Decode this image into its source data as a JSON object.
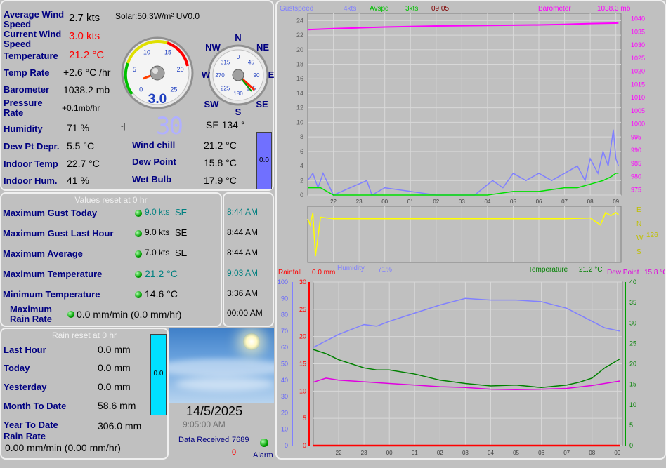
{
  "current": {
    "avg_wind_label": "Average Wind Speed",
    "avg_wind_value": "2.7 kts",
    "solar_text": "Solar:50.3W/m² UV0.0",
    "cur_wind_label": "Current Wind Speed",
    "cur_wind_value": "3.0 kts",
    "temp_label": "Temperature",
    "temp_value": "21.2 °C",
    "temp_rate_label": "Temp Rate",
    "temp_rate_value": "+2.6 °C /hr",
    "baro_label": "Barometer",
    "baro_value": "1038.2 mb",
    "pressure_rate_label": "Pressure Rate",
    "pressure_rate_value": "+0.1mb/hr",
    "humidity_label": "Humidity",
    "humidity_value": "71 %",
    "dew_depr_label": "Dew Pt Depr.",
    "dew_depr_value": "5.5 °C",
    "indoor_temp_label": "Indoor Temp",
    "indoor_temp_value": "22.7 °C",
    "indoor_hum_label": "Indoor Hum.",
    "indoor_hum_value": "41 %",
    "wind_chill_label": "Wind chill",
    "wind_chill_value": "21.2 °C",
    "dew_point_label": "Dew Point",
    "dew_point_value": "15.8 °C",
    "wet_bulb_label": "Wet Bulb",
    "wet_bulb_value": "17.9 °C",
    "wind_dir_text": "SE  134 °",
    "digital_dir": "30",
    "minus_sign": "-|",
    "gauge_value": "3.0",
    "bar_value": "0.0",
    "compass": {
      "n": "N",
      "ne": "NE",
      "e": "E",
      "se": "SE",
      "s": "S",
      "sw": "SW",
      "w": "W",
      "nw": "NW"
    }
  },
  "gauge_speed_ticks": [
    "0",
    "5",
    "10",
    "15",
    "20",
    "25"
  ],
  "gauge_compass_ticks": [
    "0",
    "45",
    "90",
    "135",
    "180",
    "225",
    "270",
    "315"
  ],
  "maxima": {
    "title": "Values reset at 0 hr",
    "rows": [
      {
        "label": "Maximum Gust Today",
        "value": "9.0 kts",
        "dir": "SE",
        "time": "8:44 AM",
        "color": "#008080"
      },
      {
        "label": "Maximum Gust Last Hour",
        "value": "9.0 kts",
        "dir": "SE",
        "time": "8:44 AM",
        "color": "#000000"
      },
      {
        "label": "Maximum Average",
        "value": "7.0 kts",
        "dir": "SE",
        "time": "8:44 AM",
        "color": "#000000"
      },
      {
        "label": "Maximum Temperature",
        "value": "21.2 °C",
        "dir": "",
        "time": "9:03 AM",
        "color": "#008080"
      },
      {
        "label": "Minimum Temperature",
        "value": "14.6 °C",
        "dir": "",
        "time": "3:36 AM",
        "color": "#000000"
      }
    ],
    "rain_rate_label": "Maximum Rain Rate",
    "rain_rate_value": "0.0 mm/min (0.0 mm/hr)",
    "rain_rate_time": "00:00 AM"
  },
  "rain": {
    "title": "Rain reset at 0 hr",
    "last_hour_label": "Last Hour",
    "last_hour_value": "0.0 mm",
    "today_label": "Today",
    "today_value": "0.0 mm",
    "yesterday_label": "Yesterday",
    "yesterday_value": "0.0 mm",
    "month_label": "Month To Date",
    "month_value": "58.6 mm",
    "year_label": "Year To Date",
    "year_value": "306.0 mm",
    "rate_label": "Rain Rate",
    "rate_value": "0.00 mm/min (0.00 mm/hr)",
    "bar_value": "0.0"
  },
  "status": {
    "date": "14/5/2025",
    "time": "9:05:00 AM",
    "data_received_label": "Data Received",
    "data_received_count": "7689",
    "error_count": "0",
    "alarm_label": "Alarm"
  },
  "chart_data": [
    {
      "type": "line",
      "legend": {
        "gust_label": "Gustspeed",
        "gust_value": "4kts",
        "avg_label": "Avspd",
        "avg_value": "3kts",
        "time": "09:05",
        "baro_label": "Barometer",
        "baro_value": "1038.3 mb"
      },
      "x_ticks": [
        "22",
        "23",
        "00",
        "01",
        "02",
        "03",
        "04",
        "05",
        "06",
        "07",
        "08",
        "09"
      ],
      "y_left_ticks": [
        "0",
        "2",
        "4",
        "6",
        "8",
        "10",
        "12",
        "14",
        "16",
        "18",
        "20",
        "22",
        "24"
      ],
      "y_right_ticks": [
        "975",
        "980",
        "985",
        "990",
        "995",
        "1000",
        "1005",
        "1010",
        "1015",
        "1020",
        "1025",
        "1030",
        "1035",
        "1040"
      ],
      "ylim_left": [
        0,
        25
      ],
      "ylim_right": [
        973,
        1042
      ],
      "series": [
        {
          "name": "Barometer",
          "color": "#ff00ff",
          "axis": "right",
          "x": [
            21.0,
            22,
            23,
            24,
            25,
            26,
            27,
            28,
            29,
            30,
            31,
            32,
            33.1
          ],
          "values": [
            1035.8,
            1036.2,
            1036.5,
            1036.8,
            1037.0,
            1037.2,
            1037.3,
            1037.4,
            1037.5,
            1037.6,
            1037.8,
            1038.1,
            1038.3
          ]
        },
        {
          "name": "Gustspeed",
          "color": "#8080ff",
          "axis": "left",
          "x": [
            21.0,
            21.2,
            21.4,
            21.6,
            22.0,
            23.3,
            23.5,
            24.0,
            26.0,
            27.5,
            28.2,
            28.6,
            29.0,
            29.5,
            30.0,
            30.5,
            31.0,
            31.5,
            31.8,
            32.0,
            32.3,
            32.5,
            32.7,
            32.9,
            33.0,
            33.1
          ],
          "values": [
            2,
            3,
            1,
            3,
            0,
            2,
            0,
            1,
            0,
            0,
            2,
            1,
            3,
            2,
            3,
            2,
            3,
            4,
            2,
            5,
            3,
            6,
            4,
            9,
            5,
            4
          ]
        },
        {
          "name": "Avspd",
          "color": "#00e000",
          "axis": "left",
          "x": [
            21.0,
            21.5,
            22.0,
            24.0,
            26.0,
            28.0,
            29.0,
            30.0,
            31.0,
            31.5,
            32.0,
            32.5,
            32.8,
            33.0,
            33.1
          ],
          "values": [
            1,
            1,
            0,
            0,
            0,
            0,
            0.5,
            0.5,
            1,
            1,
            1.5,
            2,
            2.5,
            3,
            3
          ]
        }
      ]
    },
    {
      "type": "line",
      "legend": {
        "dirs": [
          "E",
          "N",
          "W",
          "S"
        ],
        "value": "126"
      },
      "series": [
        {
          "name": "Direction",
          "color": "#ffff00",
          "x": [
            21.0,
            21.1,
            21.2,
            21.3,
            21.5,
            22.0,
            23.0,
            24.0,
            25.0,
            26.0,
            27.0,
            28.0,
            29.0,
            30.0,
            31.0,
            32.0,
            32.4,
            32.6,
            32.8,
            33.0,
            33.1
          ],
          "values": [
            100,
            60,
            140,
            -140,
            110,
            100,
            100,
            100,
            100,
            100,
            100,
            100,
            100,
            100,
            100,
            105,
            60,
            140,
            120,
            140,
            126
          ]
        }
      ]
    },
    {
      "type": "line",
      "legend": {
        "rain_label": "Rainfall",
        "rain_value": "0.0 mm",
        "hum_label": "Humidity",
        "hum_value": "71%",
        "temp_label": "Temperature",
        "temp_value": "21.2 °C",
        "dew_label": "Dew Point",
        "dew_value": "15.8 °C"
      },
      "x_ticks": [
        "22",
        "23",
        "00",
        "01",
        "02",
        "03",
        "04",
        "05",
        "06",
        "07",
        "08",
        "09"
      ],
      "y_hum_ticks": [
        "0",
        "10",
        "20",
        "30",
        "40",
        "50",
        "60",
        "70",
        "80",
        "90",
        "100"
      ],
      "y_rain_ticks": [
        "0",
        "5",
        "10",
        "15",
        "20",
        "25",
        "30"
      ],
      "y_temp_ticks": [
        "0",
        "5",
        "10",
        "15",
        "20",
        "25",
        "30",
        "35",
        "40"
      ],
      "series": [
        {
          "name": "Humidity",
          "color": "#8080ff",
          "axis": "hum",
          "x": [
            21.0,
            21.5,
            22,
            22.5,
            23,
            23.5,
            24,
            25,
            26,
            27,
            28,
            29,
            30,
            31,
            32,
            32.5,
            33.1
          ],
          "values": [
            60,
            64,
            68,
            71,
            74,
            73,
            76,
            81,
            86,
            90,
            89,
            89,
            88,
            84,
            76,
            72,
            70
          ]
        },
        {
          "name": "Temperature",
          "color": "#008000",
          "axis": "temp",
          "x": [
            21.0,
            21.5,
            22,
            22.5,
            23,
            23.5,
            24,
            25,
            26,
            27,
            28,
            29,
            30,
            31,
            31.5,
            32,
            32.5,
            33.1
          ],
          "values": [
            23.5,
            22.5,
            21.0,
            20,
            19,
            18.5,
            18.5,
            17.5,
            16,
            15.2,
            14.6,
            14.8,
            14.2,
            14.8,
            15.5,
            16.5,
            19,
            21.2
          ]
        },
        {
          "name": "Dew Point",
          "color": "#e000e0",
          "axis": "temp",
          "x": [
            21.0,
            21.5,
            22,
            23,
            24,
            25,
            26,
            27,
            28,
            29,
            30,
            31,
            32,
            33.1
          ],
          "values": [
            15.5,
            16.5,
            16,
            15.6,
            15.2,
            14.8,
            14.4,
            14.2,
            13.8,
            13.7,
            13.8,
            14.0,
            14.7,
            15.8
          ]
        },
        {
          "name": "Rainfall",
          "color": "#ff0000",
          "axis": "rain",
          "x": [
            21.0,
            33.1
          ],
          "values": [
            0,
            0
          ]
        }
      ]
    }
  ]
}
